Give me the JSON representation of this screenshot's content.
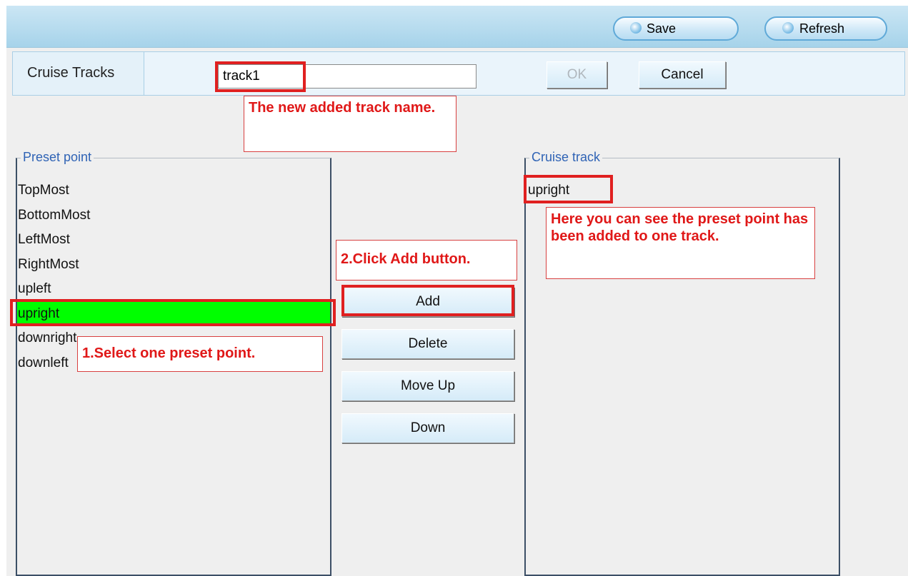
{
  "toolbar": {
    "save_label": "Save",
    "refresh_label": "Refresh"
  },
  "tracks_row": {
    "label": "Cruise Tracks",
    "input_value": "track1",
    "ok_label": "OK",
    "cancel_label": "Cancel"
  },
  "preset_panel": {
    "legend": "Preset point",
    "items": [
      "TopMost",
      "BottomMost",
      "LeftMost",
      "RightMost",
      "upleft",
      "upright",
      "downright",
      "downleft"
    ],
    "selected": "upright"
  },
  "cruise_panel": {
    "legend": "Cruise track",
    "items": [
      "upright"
    ]
  },
  "actions": {
    "add_label": "Add",
    "delete_label": "Delete",
    "move_up_label": "Move Up",
    "down_label": "Down"
  },
  "annotations": {
    "track_name_note": "The new added track name.",
    "select_note": "1.Select one preset point.",
    "add_note": "2.Click Add button.",
    "result_note": "Here you can see the preset point has been added to one track."
  },
  "colors": {
    "selected_row": "#00ff00",
    "annotation_red": "#e01818",
    "toolbar_blue": "#a6d3ea",
    "legend_blue": "#2f63b5"
  }
}
